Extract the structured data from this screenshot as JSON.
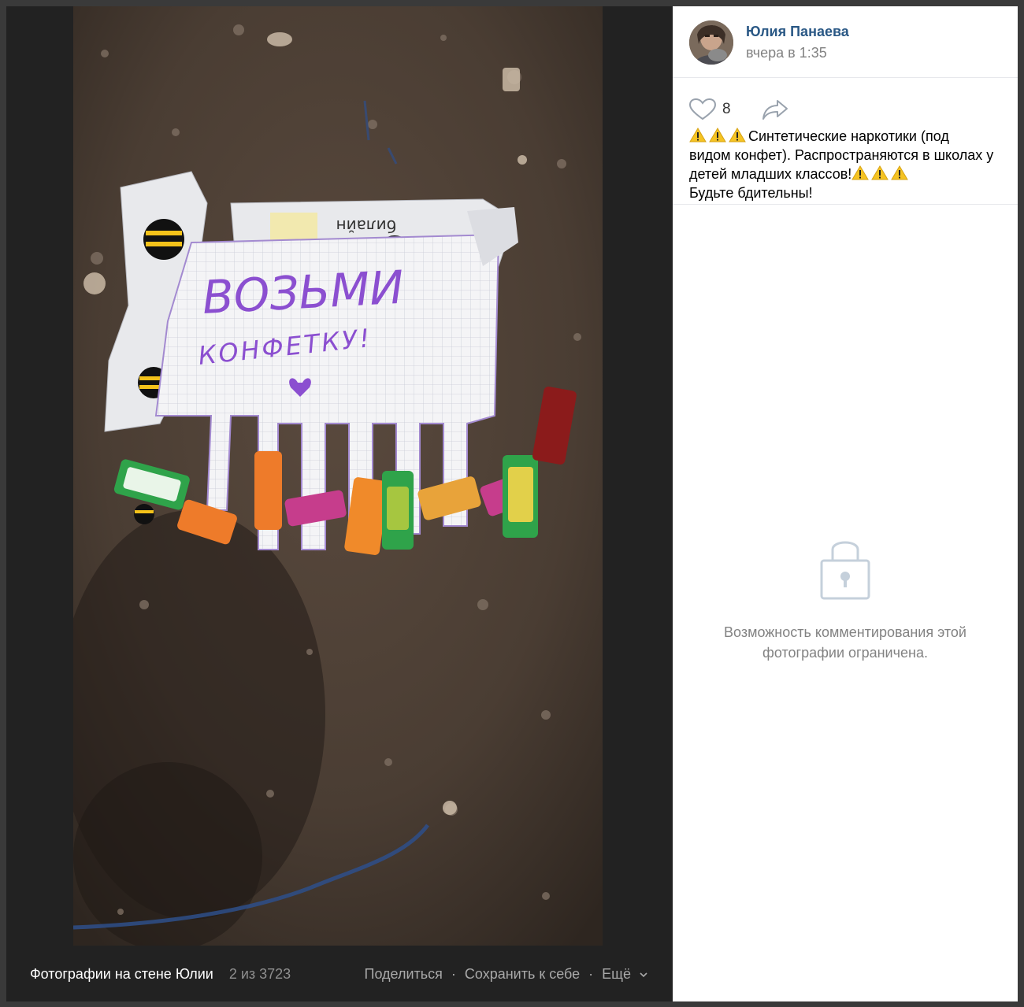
{
  "photo": {
    "note_text": "ВОЗЬМИ КОНФЕТКУ!",
    "logo_text": "билайн"
  },
  "footer": {
    "album_title": "Фотографии на стене Юлии",
    "counter": "2 из 3723",
    "share_label": "Поделиться",
    "separator": "·",
    "save_label": "Сохранить к себе",
    "more_label": "Ещё"
  },
  "post": {
    "author_name": "Юлия Панаева",
    "time": "вчера в 1:35",
    "likes": "8",
    "text_line1": "Синтетические наркотики (под видом конфет). Распространяются в школах у детей младших классов!",
    "text_line2": "Будьте бдительны!"
  },
  "comments": {
    "locked_message": "Возможность комментирования этой фотографии ограничена."
  },
  "colors": {
    "link": "#2a5885",
    "muted": "#828282",
    "viewer_bg": "#222222",
    "panel_bg": "#ffffff"
  },
  "icons": {
    "like": "heart-icon",
    "share": "share-arrow-icon",
    "lock": "lock-icon",
    "warning": "warning-icon",
    "more": "chevron-down-icon"
  }
}
